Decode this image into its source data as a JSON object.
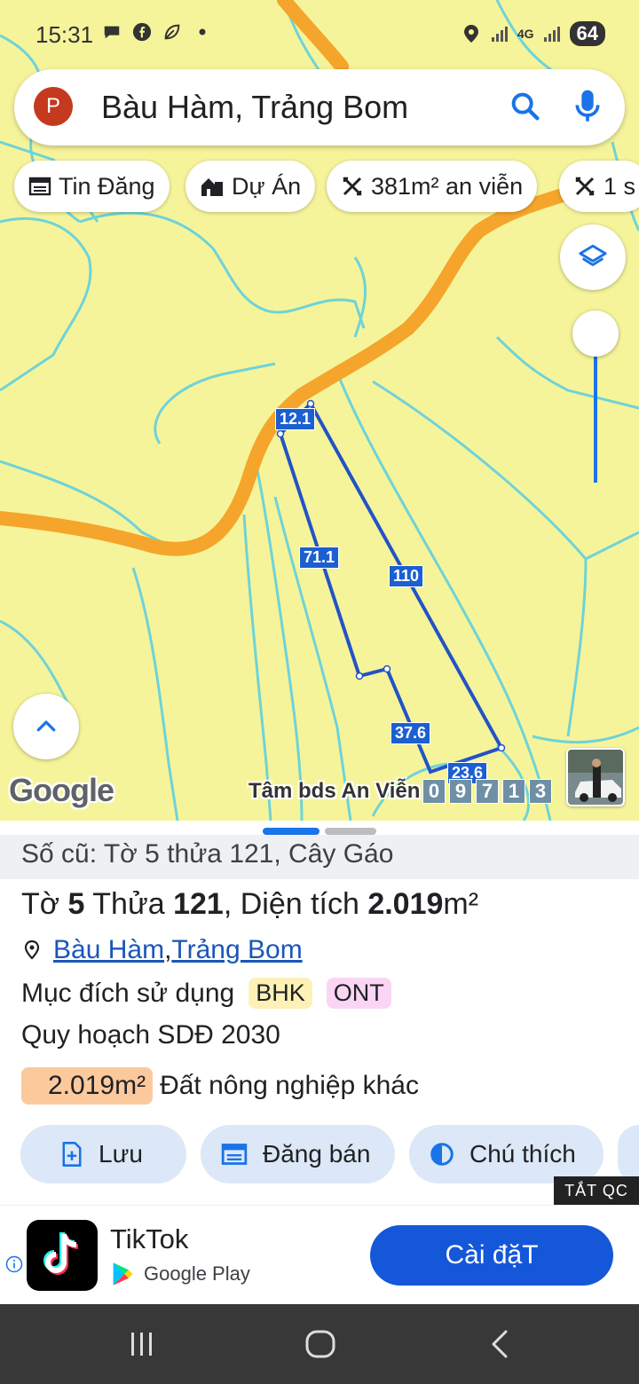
{
  "status_bar": {
    "time": "15:31",
    "network": "4G",
    "battery": "64"
  },
  "search": {
    "avatar_letter": "P",
    "query": "Bàu Hàm, Trảng Bom"
  },
  "chips": [
    {
      "label": "Tin Đăng",
      "icon": "listing-icon"
    },
    {
      "label": "Dự Án",
      "icon": "project-icon"
    },
    {
      "label": "381m² an viễn",
      "icon": "measure-icon"
    },
    {
      "label": "1 s",
      "icon": "measure-icon"
    }
  ],
  "map": {
    "attribution": "Google",
    "brand_label": "Tâm bds An Viễn",
    "phone_digits": [
      "0",
      "9",
      "7",
      "1",
      "3"
    ],
    "edge_labels": [
      "12.1",
      "110",
      "71.1",
      "37.6",
      "23.6"
    ],
    "colors": {
      "land": "#f6f49a",
      "road": "#f5a52b",
      "parcel": "#2253c7",
      "lines": "#6fd3d8"
    }
  },
  "sheet": {
    "old_ref": "Số cũ: Tờ 5 thửa 121, Cây Gáo",
    "title": {
      "sheet_prefix": "Tờ ",
      "sheet_no": "5",
      "parcel_prefix": " Thửa ",
      "parcel_no": "121",
      "area_prefix": ", Diện tích ",
      "area": "2.019",
      "area_unit": "m²"
    },
    "location": {
      "commune": "Bàu Hàm",
      "separator": ", ",
      "district": "Trảng Bom"
    },
    "purpose_label": "Mục đích sử dụng",
    "purpose_tags": [
      "BHK",
      "ONT"
    ],
    "plan": "Quy hoạch SDĐ 2030",
    "area_value": "2.019m²",
    "area_desc": "Đất nông nghiệp khác",
    "actions": [
      "Lưu",
      "Đăng bán",
      "Chú thích"
    ]
  },
  "ads_badge": "TẮT QC",
  "ad": {
    "app_name": "TikTok",
    "store": "Google Play",
    "cta": "Cài đặT"
  }
}
